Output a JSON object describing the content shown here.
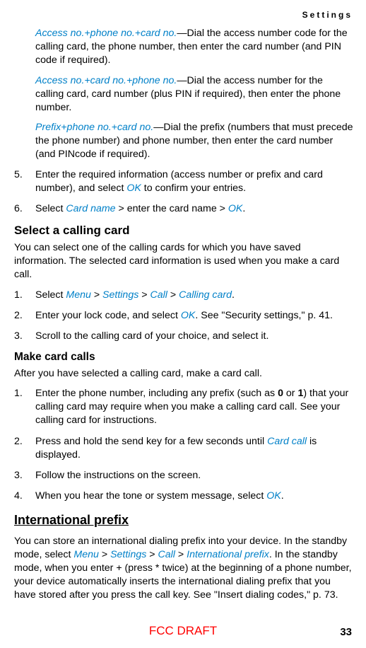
{
  "header": {
    "title": "Settings"
  },
  "dialOptions": [
    {
      "term": "Access no.+phone no.+card no.",
      "desc": "—Dial the access number code for the calling card, the phone number, then enter the card number (and PIN code if required)."
    },
    {
      "term": "Access no.+card no.+phone no.",
      "desc": "—Dial the access number for the calling card, card number (plus PIN if required), then enter the phone number."
    },
    {
      "term": "Prefix+phone no.+card no.",
      "desc": "—Dial the prefix (numbers that must precede the phone number) and phone number, then enter the card number (and PINcode if required)."
    }
  ],
  "listA": [
    {
      "num": "5.",
      "pre": "Enter the required information (access number or prefix and card number), and select ",
      "link1": "OK",
      "post": " to confirm your entries."
    },
    {
      "num": "6.",
      "pre": "Select ",
      "link1": "Card name",
      "mid": " > enter the card name > ",
      "link2": "OK",
      "post": "."
    }
  ],
  "selectCard": {
    "heading": "Select a calling card",
    "intro": "You can select one of the calling cards for which you have saved information. The selected card information is used when you make a card call.",
    "steps": [
      {
        "num": "1.",
        "parts": [
          "Select ",
          "Menu",
          " > ",
          "Settings",
          " > ",
          "Call",
          " > ",
          "Calling card",
          "."
        ]
      },
      {
        "num": "2.",
        "pre": "Enter your lock code, and select ",
        "link": "OK",
        "post": ". See \"Security settings,\" p. 41."
      },
      {
        "num": "3.",
        "text": "Scroll to the calling card of your choice, and select it."
      }
    ]
  },
  "makeCalls": {
    "heading": "Make card calls",
    "intro": "After you have selected a calling card, make a card call.",
    "steps": [
      {
        "num": "1.",
        "pre": "Enter the phone number, including any prefix (such as ",
        "bold1": "0",
        "mid1": " or ",
        "bold2": "1",
        "post": ") that your calling card may require when you make a calling card call. See your calling card for instructions."
      },
      {
        "num": "2.",
        "pre": "Press and hold the send key for a few seconds until ",
        "link": "Card call",
        "post": " is displayed."
      },
      {
        "num": "3.",
        "text": "Follow the instructions on the screen."
      },
      {
        "num": "4.",
        "pre": "When you hear the tone or system message, select ",
        "link": "OK",
        "post": "."
      }
    ]
  },
  "intlPrefix": {
    "heading": "International prefix",
    "preText": "You can store an international dialing prefix into your device. In the standby mode, select ",
    "links": [
      "Menu",
      "Settings",
      "Call",
      "International prefix"
    ],
    "sep": " > ",
    "postText": ". In the standby mode, when you enter + (press * twice) at the beginning of a phone number, your device automatically inserts the international dialing prefix that you have stored after you press the call key. See \"Insert dialing codes,\" p. 73."
  },
  "footer": {
    "draft": "FCC DRAFT",
    "page": "33"
  }
}
